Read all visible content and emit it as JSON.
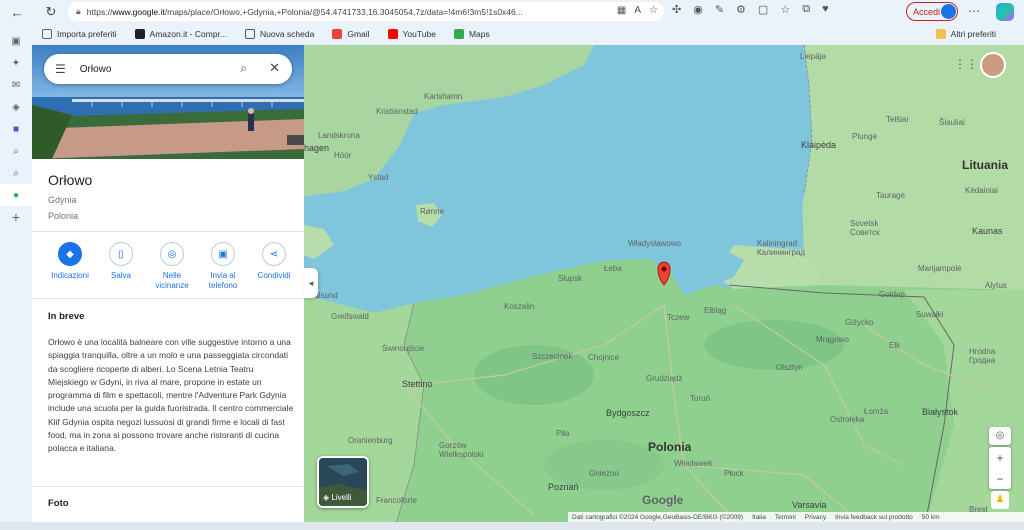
{
  "browser": {
    "url_prefix": "https://",
    "url_host": "www.google.it",
    "url_rest": "/maps/place/Orłowo,+Gdynia,+Polonia/@54.4741733,16.3045054,7z/data=!4m6!3m5!1s0x46...",
    "signin_label": "Accedi",
    "bookmarks": [
      {
        "label": "Importa preferiti",
        "color": "#6b6b6b"
      },
      {
        "label": "Amazon.it - Compr...",
        "color": "#222222"
      },
      {
        "label": "Nuova scheda",
        "color": "#555555"
      },
      {
        "label": "Gmail",
        "color": "#ea4335"
      },
      {
        "label": "YouTube",
        "color": "#ff0000"
      },
      {
        "label": "Maps",
        "color": "#34a853"
      }
    ],
    "other_bookmarks": "Altri preferiti"
  },
  "search": {
    "query": "Orłowo"
  },
  "place": {
    "name": "Orłowo",
    "city": "Gdynia",
    "country": "Polonia",
    "actions": [
      {
        "label": "Indicazioni",
        "icon": "directions-icon",
        "glyph": "◆"
      },
      {
        "label": "Salva",
        "icon": "bookmark-icon",
        "glyph": "▯"
      },
      {
        "label": "Nelle vicinanze",
        "icon": "nearby-icon",
        "glyph": "◎"
      },
      {
        "label": "Invia al telefono",
        "icon": "phone-icon",
        "glyph": "▣"
      },
      {
        "label": "Condividi",
        "icon": "share-icon",
        "glyph": "⋖"
      }
    ],
    "section_title": "In breve",
    "description": "Orłowo è una località balneare con ville suggestive intorno a una spiaggia tranquilla, oltre a un molo e una passeggiata circondati da scogliere ricoperte di alberi. Lo Scena Letnia Teatru Miejskiego w Gdyni, in riva al mare, propone in estate un programma di film e spettacoli, mentre l'Adventure Park Gdynia include una scuola per la guida fuoristrada.  Il centro commerciale Klif Gdynia ospita negozi lussuosi di grandi firme e locali di fast food, ma in zona si possono trovare anche ristoranti di cucina polacca e italiana.",
    "photos_title": "Foto"
  },
  "map": {
    "labels": {
      "poland": "Polonia",
      "lithuania": "Lituania",
      "klaipeda": "Klaipėda",
      "kaunas": "Kaunas",
      "bialystok": "Białystok",
      "warsaw": "Varsavia",
      "bydgoszcz": "Bydgoszcz",
      "stettino": "Stettino",
      "kaliningrad": "Kaliningrad\nКалининград",
      "koszalin": "Koszalin",
      "slupsk": "Słupsk",
      "elblag": "Elbląg",
      "grudziadz": "Grudziądz",
      "torun": "Toruń",
      "poznan": "Poznań",
      "wloclawek": "Włocławek",
      "plock": "Płock",
      "olsztyn": "Olsztyn",
      "lomza": "Łomża",
      "suwalki": "Suwałki",
      "szczecinek": "Szczecinek",
      "leba": "Łeba",
      "wladyslawowo": "Władysławowo",
      "tczew": "Tczew",
      "karlshamn": "Karlshamn",
      "kristianstad": "Kristianstad",
      "ystad": "Ystad",
      "ronne": "Rønne",
      "liepaja": "Liepāja",
      "siauliai": "Šiauliai",
      "telsiai": "Telšiai",
      "plunge": "Plungė",
      "taurage": "Tauragė",
      "marijampole": "Marijampolė",
      "alytus": "Alytus",
      "grodno": "Hrodna\nГродна",
      "brest": "Brest",
      "sovetsk": "Sovetsk\nСоветск",
      "kedainiai": "Kėdainiai",
      "greifswald": "Greifswald",
      "swinoujscie": "Świnoujście",
      "pila": "Piła",
      "gorzow": "Gorzów\nWielkopolski",
      "gniezno": "Gniezno",
      "mragowo": "Mrągowo",
      "gizycko": "Giżycko",
      "elk": "Ełk",
      "ostroleka": "Ostrołęka",
      "chojnice": "Chojnice",
      "oranienburg": "Oranienburg",
      "frankfurt": "Francoforte",
      "goldap": "Gołdap",
      "hagen": "hagen",
      "sassnitz": "Stralsund",
      "kalingrad_small": "Landskrona",
      "hoor": "Höör"
    },
    "layers_label": "Livelli",
    "attribution": [
      "Dati cartografici ©2024 Google,GeoBasis-DE/BKG (©2009)",
      "Italia",
      "Termini",
      "Privacy",
      "Invia feedback sul prodotto",
      "50 km"
    ],
    "google_logo": "Google"
  }
}
